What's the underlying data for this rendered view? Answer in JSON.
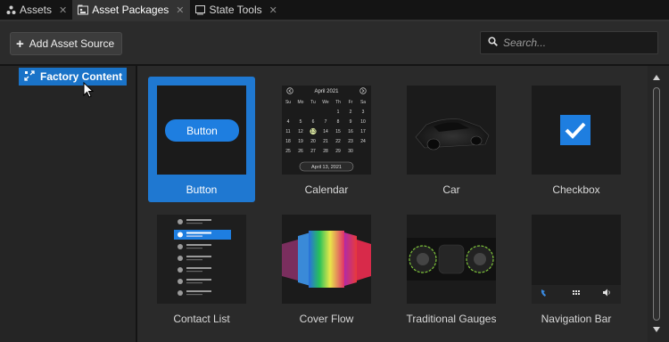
{
  "tabs": [
    {
      "label": "Assets",
      "icon": "assets-icon",
      "active": false
    },
    {
      "label": "Asset Packages",
      "icon": "asset-packages-icon",
      "active": true
    },
    {
      "label": "State Tools",
      "icon": "state-tools-icon",
      "active": false
    }
  ],
  "toolbar": {
    "add_label": "Add Asset Source",
    "search_placeholder": "Search..."
  },
  "tree": {
    "selected_label": "Factory Content"
  },
  "assets": [
    {
      "label": "Button",
      "selected": true,
      "preview_text": "Button"
    },
    {
      "label": "Calendar",
      "selected": false,
      "calendar": {
        "month": "April 2021",
        "days": [
          "Su",
          "Mo",
          "Tu",
          "We",
          "Th",
          "Fr",
          "Sa"
        ],
        "selected_date": "April 13, 2021"
      }
    },
    {
      "label": "Car",
      "selected": false
    },
    {
      "label": "Checkbox",
      "selected": false
    },
    {
      "label": "Contact List",
      "selected": false
    },
    {
      "label": "Cover Flow",
      "selected": false
    },
    {
      "label": "Traditional Gauges",
      "selected": false
    },
    {
      "label": "Navigation Bar",
      "selected": false
    }
  ],
  "colors": {
    "accent": "#1f78d1",
    "background": "#2a2a2a",
    "tab_strip": "#141414"
  }
}
